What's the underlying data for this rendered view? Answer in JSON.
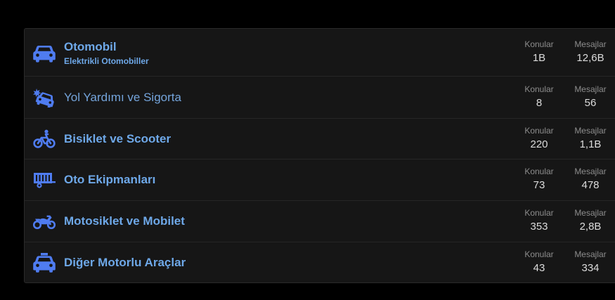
{
  "colors": {
    "accent": "#4f7cf0",
    "link": "#6ea8e8",
    "panel_bg": "#161616",
    "page_bg": "#000000"
  },
  "labels": {
    "topics": "Konular",
    "messages": "Mesajlar"
  },
  "forums": [
    {
      "icon": "car-icon",
      "title": "Otomobil",
      "subforum": "Elektrikli Otomobiller",
      "unread": true,
      "topics": "1B",
      "messages": "12,6B"
    },
    {
      "icon": "car-crash-icon",
      "title": "Yol Yardımı ve Sigorta",
      "unread": false,
      "topics": "8",
      "messages": "56"
    },
    {
      "icon": "bicycle-icon",
      "title": "Bisiklet ve Scooter",
      "unread": true,
      "topics": "220",
      "messages": "1,1B"
    },
    {
      "icon": "trailer-icon",
      "title": "Oto Ekipmanları",
      "unread": true,
      "topics": "73",
      "messages": "478"
    },
    {
      "icon": "motorcycle-icon",
      "title": "Motosiklet ve Mobilet",
      "unread": true,
      "topics": "353",
      "messages": "2,8B"
    },
    {
      "icon": "taxi-icon",
      "title": "Diğer Motorlu Araçlar",
      "unread": true,
      "topics": "43",
      "messages": "334"
    }
  ]
}
